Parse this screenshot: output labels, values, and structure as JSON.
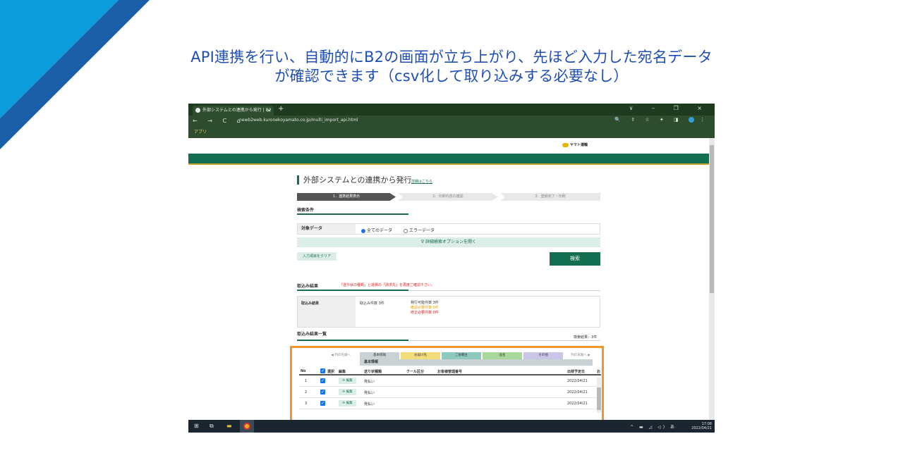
{
  "slide": {
    "caption_line1": "API連携を行い、自動的にB2の画面が立ち上がり、先ほど入力した宛名データ",
    "caption_line2": "が確認できます（csv化して取り込みする必要なし）",
    "accent_color": "#1f4fb4"
  },
  "browser": {
    "tab_title": "外部システムとの連携から発行 | B2",
    "tab_close": "×",
    "new_tab": "+",
    "window_controls": "∨ – ❐ ×",
    "nav_icons": "← → C ⌂",
    "url": "newb2web.kuronekoyamato.co.jp/multi_import_api.html",
    "right_icons": "🔍 ⇪ ☆ ✦ ◨",
    "menu_icon": "⋮",
    "bookmark": "アプリ"
  },
  "page": {
    "logo": "ヤマト運輸",
    "title": "外部システムとの連携から発行",
    "detail_link": "詳細はこちら",
    "steps": [
      "1．連携結果表示",
      "2．印刷内容の確認",
      "3．登録完了・印刷"
    ],
    "search_section": "検索条件",
    "target_label": "対象データ",
    "radio_all": "全てのデータ",
    "radio_error": "エラーデータ",
    "options_toggle": "∇ 詳細検索オプションを開く",
    "clear_button": "入力項目をクリア",
    "search_button": "検索",
    "result_section": "取込み結果",
    "result_note": "「送り状の種類」と運賃の「請求先」を再度ご確認下さい。",
    "result_label": "取込み結果",
    "import_count": "取込み件数 3件",
    "stat_issuable": "発行可能件数 3件",
    "stat_confirm": "確認必要件数 0件",
    "stat_fix": "修正必要件数 0件",
    "list_section": "取込み結果一覧",
    "hit_count": "検索結果：3件",
    "categories": [
      {
        "label": "列の先頭へ",
        "color": "#ffffff"
      },
      {
        "label": "基本情報",
        "color": "#c9d3d6"
      },
      {
        "label": "お届け先",
        "color": "#f3dd7a"
      },
      {
        "label": "ご依頼主",
        "color": "#8cc9bf"
      },
      {
        "label": "品名",
        "color": "#a9d99a"
      },
      {
        "label": "その他",
        "color": "#c9c6e8"
      },
      {
        "label": "列の末尾へ",
        "color": "#ffffff"
      }
    ],
    "group_header": "基本情報",
    "columns": {
      "no": "No",
      "select": "選択",
      "edit": "編集",
      "invoice_type": "送り状種類",
      "cool": "クール区分",
      "customer_no": "お客様管理番号",
      "ship_date": "出荷予定日",
      "more": "お"
    },
    "rows": [
      {
        "no": "1",
        "edit": "⟳ 編集",
        "type": "発払い",
        "date": "2022/04/21"
      },
      {
        "no": "2",
        "edit": "⟳ 編集",
        "type": "発払い",
        "date": "2022/04/21"
      },
      {
        "no": "3",
        "edit": "⟳ 編集",
        "type": "発払い",
        "date": "2022/04/21"
      }
    ]
  },
  "taskbar": {
    "start": "⊞",
    "taskview": "⧉",
    "explorer": "▬",
    "tray": "^ ▬ ◿ ◁) あ",
    "time": "17:08",
    "date": "2022/04/21"
  }
}
